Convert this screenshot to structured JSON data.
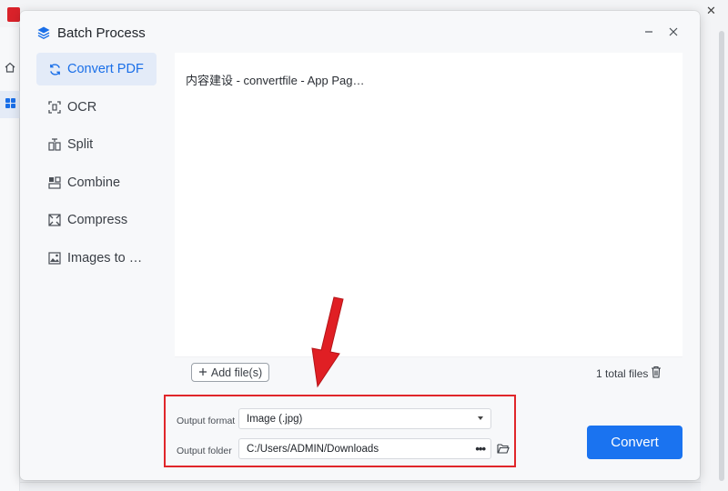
{
  "dialog": {
    "title": "Batch Process"
  },
  "nav": {
    "items": [
      {
        "label": "Convert PDF",
        "icon": "convert-icon",
        "active": true
      },
      {
        "label": "OCR",
        "icon": "ocr-icon",
        "active": false
      },
      {
        "label": "Split",
        "icon": "split-icon",
        "active": false
      },
      {
        "label": "Combine",
        "icon": "combine-icon",
        "active": false
      },
      {
        "label": "Compress",
        "icon": "compress-icon",
        "active": false
      },
      {
        "label": "Images to …",
        "icon": "images-icon",
        "active": false
      }
    ]
  },
  "files": {
    "list": [
      "内容建设 - convertfile - App Pag…"
    ],
    "add_label": "Add file(s)",
    "total_label": "1 total files"
  },
  "settings": {
    "format_label": "Output format",
    "format_value": "Image (.jpg)",
    "folder_label": "Output folder",
    "folder_value": "C:/Users/ADMIN/Downloads",
    "more_label": "•••"
  },
  "actions": {
    "convert_label": "Convert"
  },
  "colors": {
    "accent": "#1a73f0",
    "highlight_frame": "#e0262a",
    "arrow": "#e01f24"
  }
}
